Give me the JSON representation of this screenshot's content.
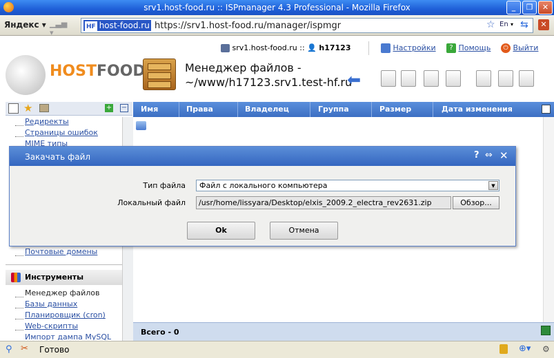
{
  "window": {
    "title": "srv1.host-food.ru :: ISPmanager 4.3 Professional - Mozilla Firefox",
    "icons": [
      "firefox-icon"
    ]
  },
  "navbar": {
    "yandex_label": "Яндекс",
    "url_badge": "host-food.ru",
    "url_badge_short": "HF",
    "url": "https://srv1.host-food.ru/manager/ispmgr",
    "lang": "En"
  },
  "header": {
    "server": "srv1.host-food.ru ::",
    "user": "h17123",
    "settings_label": "Настройки",
    "help_label": "Помощь",
    "logout_label": "Выйти",
    "logo_host": "HOST",
    "logo_food": "FOOD",
    "page_title_line1": "Менеджер файлов -",
    "page_title_line2": "~/www/h17123.srv1.test-hf.ru"
  },
  "sidebar": {
    "top_items": [
      "Редиректы",
      "Страницы ошибок",
      "MIME типы"
    ],
    "mail_item": "Почтовые домены",
    "tools_title": "Инструменты",
    "tools_items": [
      "Менеджер файлов",
      "Базы данных",
      "Планировщик (cron)",
      "Web-скрипты",
      "Импорт дампа MySQL"
    ]
  },
  "table": {
    "columns": [
      "Имя",
      "Права",
      "Владелец",
      "Группа",
      "Размер",
      "Дата изменения"
    ],
    "total_label": "Всего - 0"
  },
  "status": {
    "text": "Готово"
  },
  "dialog": {
    "title": "Закачать файл",
    "type_label": "Тип файла",
    "type_value": "Файл с локального компьютера",
    "file_label": "Локальный файл",
    "file_value": "/usr/home/lissyara/Desktop/elxis_2009.2_electra_rev2631.zip",
    "browse_label": "Обзор...",
    "ok_label": "Ok",
    "cancel_label": "Отмена",
    "help_glyph": "?"
  },
  "colors": {
    "accent": "#3c6fc3",
    "logo_orange": "#f08c1e",
    "titlebar": "#1f5fd8"
  }
}
